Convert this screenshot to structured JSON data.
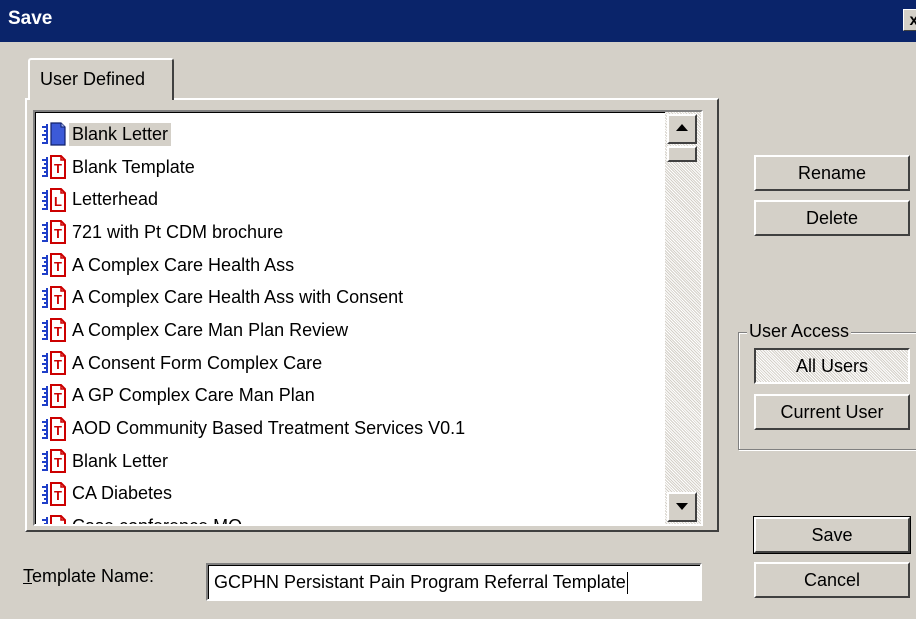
{
  "window": {
    "title": "Save",
    "close_label": "x"
  },
  "tabs": [
    {
      "label": "User Defined"
    }
  ],
  "list": {
    "items": [
      {
        "label": "Blank Letter",
        "icon": "blank-letter-icon",
        "type": "blank",
        "selected": true
      },
      {
        "label": "Blank Template",
        "icon": "template-icon",
        "type": "T"
      },
      {
        "label": "Letterhead",
        "icon": "letterhead-icon",
        "type": "L"
      },
      {
        "label": "721 with Pt CDM brochure",
        "icon": "template-icon",
        "type": "T"
      },
      {
        "label": "A Complex Care Health Ass",
        "icon": "template-icon",
        "type": "T"
      },
      {
        "label": "A Complex Care Health Ass with Consent",
        "icon": "template-icon",
        "type": "T"
      },
      {
        "label": "A Complex Care Man Plan Review",
        "icon": "template-icon",
        "type": "T"
      },
      {
        "label": "A Consent Form Complex Care",
        "icon": "template-icon",
        "type": "T"
      },
      {
        "label": "A GP Complex Care Man Plan",
        "icon": "template-icon",
        "type": "T"
      },
      {
        "label": "AOD Community Based Treatment Services V0.1",
        "icon": "template-icon",
        "type": "T"
      },
      {
        "label": "Blank Letter",
        "icon": "template-icon",
        "type": "T"
      },
      {
        "label": "CA Diabetes",
        "icon": "template-icon",
        "type": "T"
      },
      {
        "label": "Case conference MO",
        "icon": "template-icon",
        "type": "T"
      }
    ]
  },
  "buttons": {
    "rename": "Rename",
    "delete": "Delete",
    "save": "Save",
    "cancel": "Cancel"
  },
  "user_access": {
    "legend": "User Access",
    "all_users": "All Users",
    "current_user": "Current User",
    "selected": "All Users"
  },
  "template_name": {
    "label_prefix": "T",
    "label_rest": "emplate Name:",
    "value": "GCPHN Persistant Pain Program Referral Template"
  },
  "colors": {
    "titlebar": "#0a246a",
    "face": "#d4d0c8",
    "icon_red": "#cc0000",
    "icon_blue": "#1f3fc8"
  }
}
